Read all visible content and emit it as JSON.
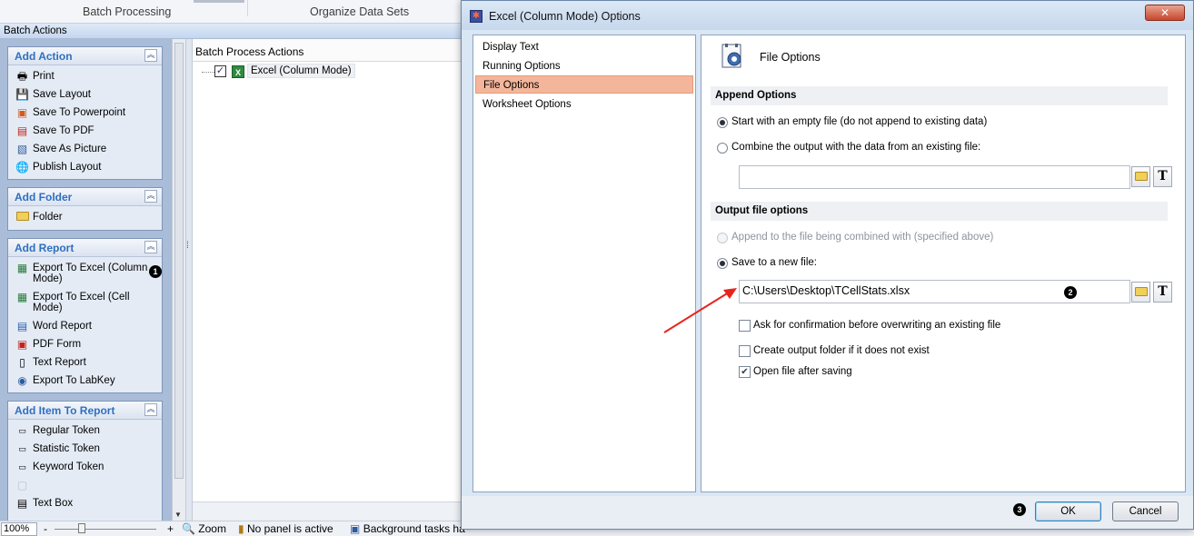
{
  "ribbon": {
    "tabs": [
      "Batch Processing",
      "Organize Data Sets"
    ]
  },
  "batch_bar": {
    "title": "Batch Actions"
  },
  "left_pane": {
    "groups": [
      {
        "title": "Add Action",
        "items": [
          {
            "label": "Print",
            "icon": "printer-icon"
          },
          {
            "label": "Save Layout",
            "icon": "save-layout-icon"
          },
          {
            "label": "Save To Powerpoint",
            "icon": "powerpoint-icon"
          },
          {
            "label": "Save To PDF",
            "icon": "pdf-icon"
          },
          {
            "label": "Save As Picture",
            "icon": "picture-icon"
          },
          {
            "label": "Publish Layout",
            "icon": "globe-icon"
          }
        ]
      },
      {
        "title": "Add Folder",
        "items": [
          {
            "label": "Folder",
            "icon": "folder-icon"
          }
        ]
      },
      {
        "title": "Add Report",
        "items": [
          {
            "label": "Export To Excel (Column Mode)",
            "icon": "excel-icon"
          },
          {
            "label": "Export To Excel (Cell Mode)",
            "icon": "excel-icon"
          },
          {
            "label": "Word Report",
            "icon": "word-icon"
          },
          {
            "label": "PDF Form",
            "icon": "pdf-form-icon"
          },
          {
            "label": "Text Report",
            "icon": "text-report-icon"
          },
          {
            "label": "Export To LabKey",
            "icon": "labkey-icon"
          }
        ]
      },
      {
        "title": "Add Item To Report",
        "items": [
          {
            "label": "Regular Token",
            "icon": "token-icon"
          },
          {
            "label": "Statistic Token",
            "icon": "token-icon"
          },
          {
            "label": "Keyword Token",
            "icon": "token-icon"
          },
          {
            "label": "",
            "icon": "disabled-item-icon"
          },
          {
            "label": "Text Box",
            "icon": "text-box-icon"
          }
        ]
      }
    ]
  },
  "center_pane": {
    "header": "Batch Process Actions",
    "tree_item": "Excel (Column Mode)"
  },
  "status_bar": {
    "zoom": "100%",
    "minus": "-",
    "plus": "+",
    "zoom_label": "Zoom",
    "panel_status": "No panel is active",
    "tasks_status": "Background tasks ha"
  },
  "dialog": {
    "title": "Excel (Column Mode) Options",
    "close": "✕",
    "nav": [
      "Display Text",
      "Running Options",
      "File Options",
      "Worksheet Options"
    ],
    "selected_nav": 2,
    "panel_title": "File Options",
    "append_section": "Append Options",
    "append_opt1": "Start with an empty file (do not append to existing data)",
    "append_opt2": "Combine the output with the data from an existing file:",
    "existing_file_value": "",
    "output_section": "Output file options",
    "output_opt1": "Append to the file being combined with (specified above)",
    "output_opt2": "Save to a new file:",
    "new_file_path": "C:\\Users\\Desktop\\TCellStats.xlsx",
    "check1": "Ask for confirmation before overwriting an existing file",
    "check2": "Create output folder if it does not exist",
    "check3": "Open file after saving",
    "check3_mark": "✔",
    "ok": "OK",
    "cancel": "Cancel"
  },
  "badges": [
    "1",
    "2",
    "3"
  ],
  "annotation": {
    "arrow_color": "#e8241c"
  }
}
